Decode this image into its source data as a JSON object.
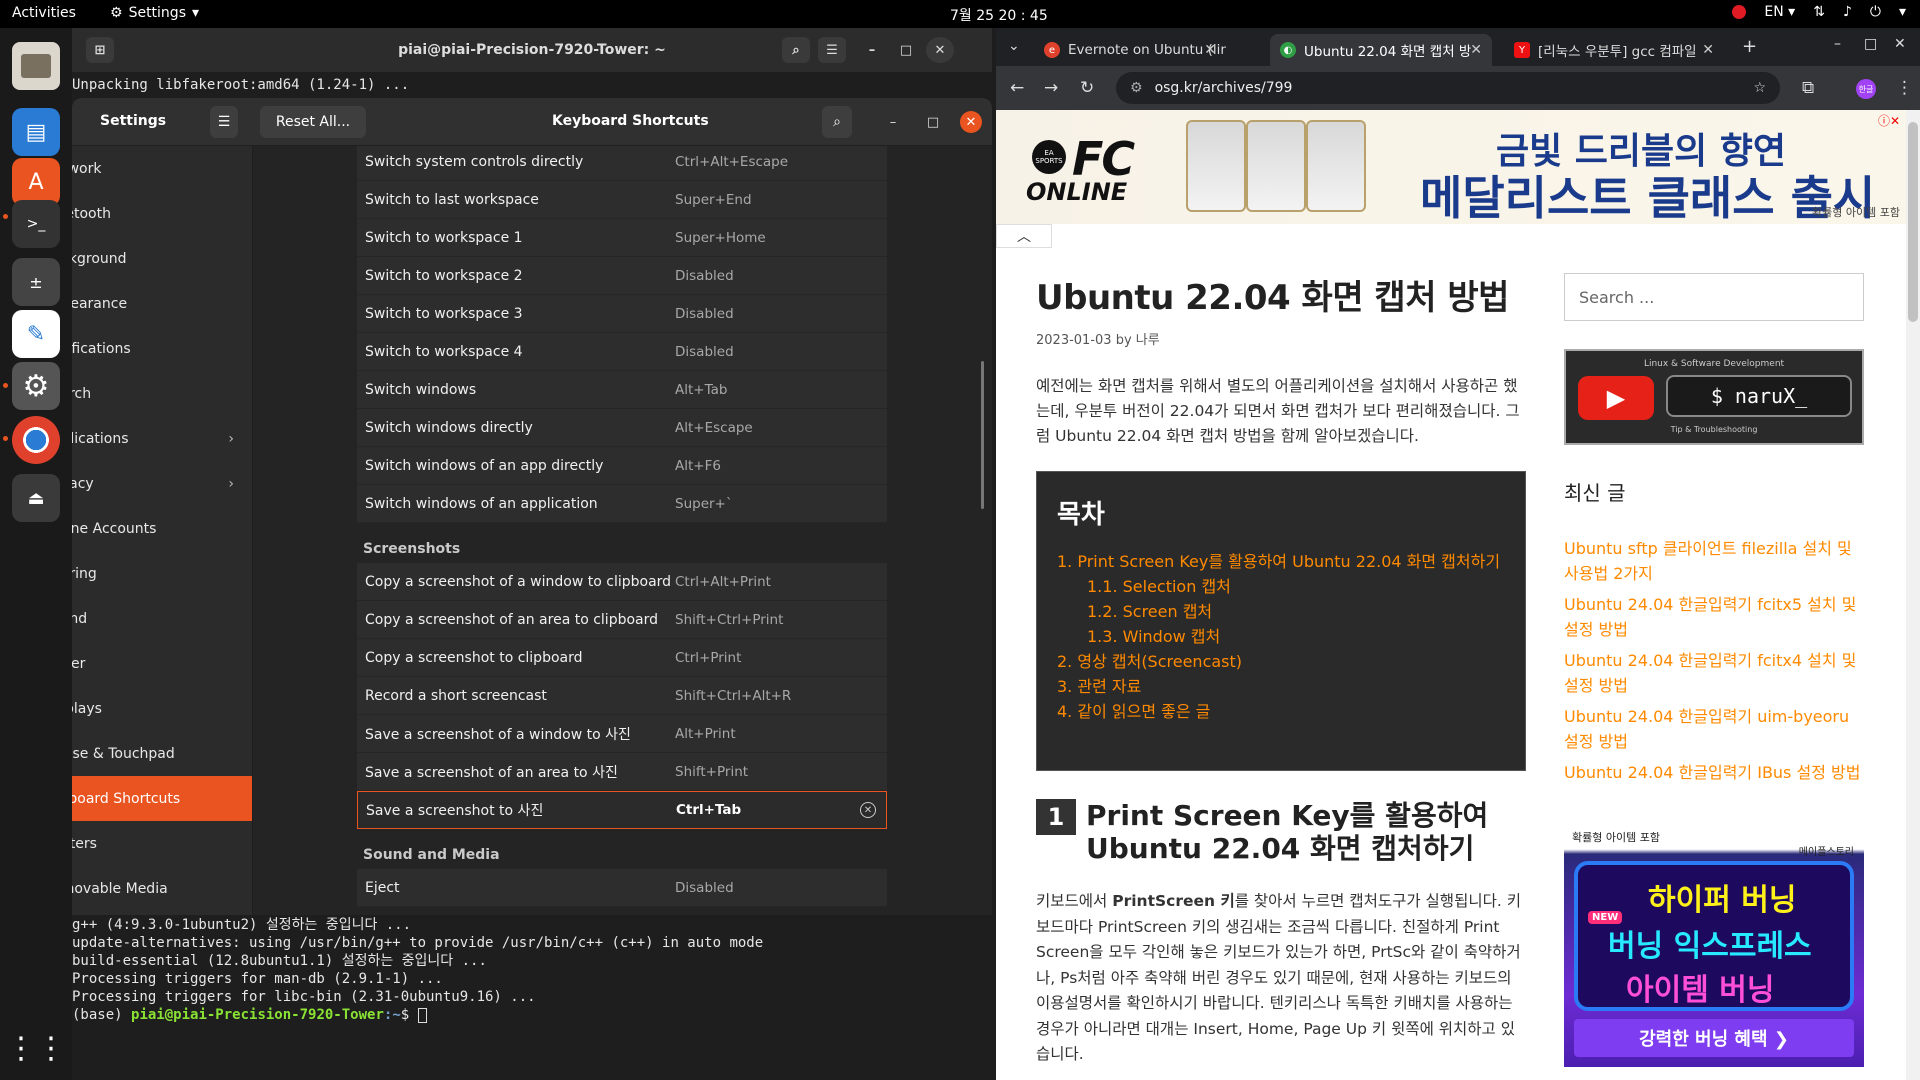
{
  "topbar": {
    "activities": "Activities",
    "app_menu": "Settings",
    "clock": "7월 25  20 : 45",
    "lang": "EN"
  },
  "terminal": {
    "title": "piai@piai-Precision-7920-Tower: ~",
    "top_line": "Unpacking libfakeroot:amd64 (1.24-1) ...",
    "lines": [
      "g++ (4:9.3.0-1ubuntu2) 설정하는 중입니다 ...",
      "update-alternatives: using /usr/bin/g++ to provide /usr/bin/c++ (c++) in auto mode",
      "build-essential (12.8ubuntu1.1) 설정하는 중입니다 ...",
      "Processing triggers for man-db (2.9.1-1) ...",
      "Processing triggers for libc-bin (2.31-0ubuntu9.16) ..."
    ],
    "prompt_env": "(base) ",
    "prompt_user": "piai@piai-Precision-7920-Tower",
    "prompt_path": ":~",
    "prompt_symbol": "$ "
  },
  "settings": {
    "title": "Settings",
    "reset_label": "Reset All...",
    "page_title": "Keyboard Shortcuts",
    "sidebar": [
      {
        "label": "Network",
        "chevron": false
      },
      {
        "label": "Bluetooth",
        "chevron": false
      },
      {
        "label": "Background",
        "chevron": false
      },
      {
        "label": "Appearance",
        "chevron": false
      },
      {
        "label": "Notifications",
        "chevron": false
      },
      {
        "label": "Search",
        "chevron": false
      },
      {
        "label": "Applications",
        "chevron": true
      },
      {
        "label": "Privacy",
        "chevron": true
      },
      {
        "label": "Online Accounts",
        "chevron": false
      },
      {
        "label": "Sharing",
        "chevron": false
      },
      {
        "label": "Sound",
        "chevron": false
      },
      {
        "label": "Power",
        "chevron": false
      },
      {
        "label": "Displays",
        "chevron": false
      },
      {
        "label": "Mouse & Touchpad",
        "chevron": false
      },
      {
        "label": "Keyboard Shortcuts",
        "chevron": false
      },
      {
        "label": "Printers",
        "chevron": false
      },
      {
        "label": "Removable Media",
        "chevron": false
      }
    ],
    "active_index": 14,
    "group1": [
      {
        "name": "Switch system controls directly",
        "accel": "Ctrl+Alt+Escape"
      },
      {
        "name": "Switch to last workspace",
        "accel": "Super+End"
      },
      {
        "name": "Switch to workspace 1",
        "accel": "Super+Home"
      },
      {
        "name": "Switch to workspace 2",
        "accel": "Disabled"
      },
      {
        "name": "Switch to workspace 3",
        "accel": "Disabled"
      },
      {
        "name": "Switch to workspace 4",
        "accel": "Disabled"
      },
      {
        "name": "Switch windows",
        "accel": "Alt+Tab"
      },
      {
        "name": "Switch windows directly",
        "accel": "Alt+Escape"
      },
      {
        "name": "Switch windows of an app directly",
        "accel": "Alt+F6"
      },
      {
        "name": "Switch windows of an application",
        "accel": "Super+`"
      }
    ],
    "screenshots_heading": "Screenshots",
    "group2": [
      {
        "name": "Copy a screenshot of a window to clipboard",
        "accel": "Ctrl+Alt+Print"
      },
      {
        "name": "Copy a screenshot of an area to clipboard",
        "accel": "Shift+Ctrl+Print"
      },
      {
        "name": "Copy a screenshot to clipboard",
        "accel": "Ctrl+Print"
      },
      {
        "name": "Record a short screencast",
        "accel": "Shift+Ctrl+Alt+R"
      },
      {
        "name": "Save a screenshot of a window to 사진",
        "accel": "Alt+Print"
      },
      {
        "name": "Save a screenshot of an area to 사진",
        "accel": "Shift+Print"
      },
      {
        "name": "Save a screenshot to 사진",
        "accel": "Ctrl+Tab"
      }
    ],
    "sound_heading": "Sound and Media",
    "group3": [
      {
        "name": "Eject",
        "accel": "Disabled"
      }
    ]
  },
  "browser": {
    "tabs": [
      {
        "title": "Evernote on Ubuntu (lin",
        "active": false
      },
      {
        "title": "Ubuntu 22.04 화면 캡처 방",
        "active": true
      },
      {
        "title": "[리눅스 우분투] gcc 컴파일",
        "active": false
      }
    ],
    "url": "osg.kr/archives/799",
    "profile_label": "한글"
  },
  "banner": {
    "logo_line1": "FC",
    "logo_line2": "ONLINE",
    "ea_label": "EA SPORTS",
    "title1": "금빛 드리블의 향연",
    "title2": "메달리스트 클래스 출시",
    "note": "확률형 아이템 포함"
  },
  "article": {
    "title": "Ubuntu 22.04 화면 캡처 방법",
    "date": "2023-01-03",
    "by": "by",
    "author": "나루",
    "intro": "예전에는 화면 캡처를 위해서 별도의 어플리케이션을 설치해서 사용하곤 했는데, 우분투 버전이 22.04가 되면서 화면 캡처가 보다 편리해졌습니다. 그럼 Ubuntu 22.04 화면 캡처 방법을 함께 알아보겠습니다.",
    "toc_title": "목차",
    "toc": [
      {
        "text": "1. Print Screen Key를 활용하여 Ubuntu 22.04 화면 캡처하기",
        "sub": false
      },
      {
        "text": "1.1. Selection 캡처",
        "sub": true
      },
      {
        "text": "1.2. Screen 캡처",
        "sub": true
      },
      {
        "text": "1.3. Window 캡처",
        "sub": true
      },
      {
        "text": "2. 영상 캡처(Screencast)",
        "sub": false
      },
      {
        "text": "3. 관련 자료",
        "sub": false
      },
      {
        "text": "4. 같이 읽으면 좋은 글",
        "sub": false
      }
    ],
    "section_num": "1",
    "section_title": "Print Screen Key를 활용하여 Ubuntu 22.04 화면 캡처하기",
    "body_pre": "키보드에서 ",
    "body_bold": "PrintScreen 키",
    "body_post": "를 찾아서 누르면 캡처도구가 실행됩니다. 키보드마다 PrintScreen 키의 생김새는 조금씩 다릅니다. 친절하게 Print Screen을 모두 각인해 놓은 키보드가 있는가 하면, PrtSc와 같이 축약하거나, Ps처럼 아주 축약해 버린 경우도 있기 때문에, 현재 사용하는 키보드의 이용설명서를 확인하시기 바랍니다. 텐키리스나 독특한 키배치를 사용하는 경우가 아니라면 대개는 Insert, Home, Page Up 키 윗쪽에 위치하고 있습니다."
  },
  "sidebar": {
    "search_placeholder": "Search ...",
    "yt_top": "Linux & Software Development",
    "yt_cmd": "$ naruX_",
    "yt_bottom": "Tip & Troubleshooting",
    "recent_title": "최신 글",
    "recent": [
      "Ubuntu sftp 클라이언트 filezilla 설치 및 사용법 2가지",
      "Ubuntu 24.04 한글입력기 fcitx5 설치 및 설정 방법",
      "Ubuntu 24.04 한글입력기 fcitx4 설치 및 설정 방법",
      "Ubuntu 24.04 한글입력기 uim-byeoru 설정 방법",
      "Ubuntu 24.04 한글입력기 IBus 설정 방법"
    ],
    "ad_note": "확률형 아이템 포함",
    "ad_brand": "메이플스토리",
    "ad_line1": "하이퍼 버닝",
    "ad_line2": "버닝 익스프레스",
    "ad_line3": "아이템 버닝",
    "ad_new": "NEW",
    "ad_button": "강력한 버닝 혜택 ❯"
  },
  "colors": {
    "accent": "#e95420",
    "link": "#ff8a00"
  }
}
